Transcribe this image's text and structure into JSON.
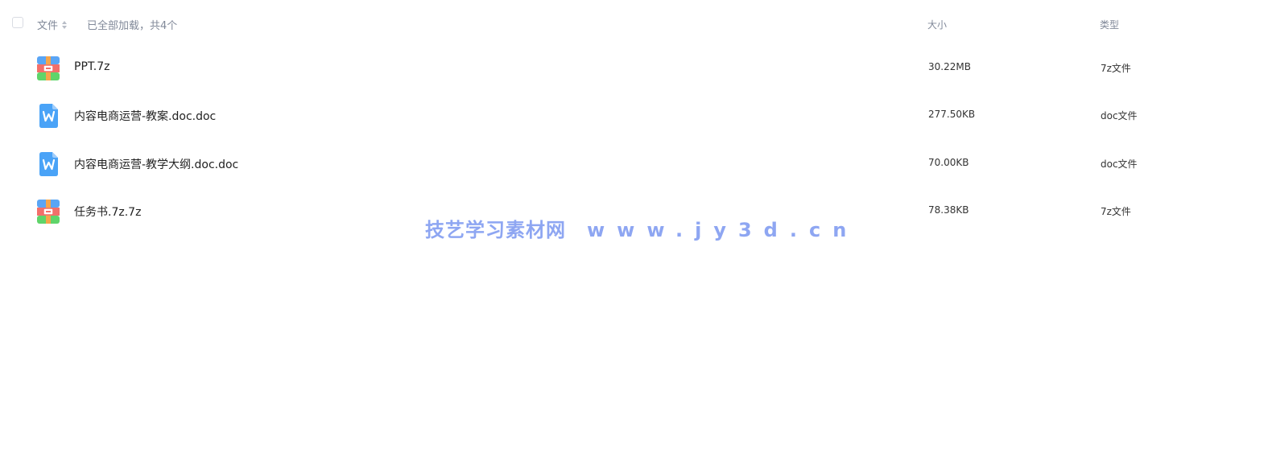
{
  "header": {
    "name_label": "文件",
    "load_status": "已全部加载，共4个",
    "size_label": "大小",
    "type_label": "类型"
  },
  "files": [
    {
      "name": "PPT.7z",
      "size": "30.22MB",
      "type": "7z文件",
      "icon": "archive-icon"
    },
    {
      "name": "内容电商运营-教案.doc.doc",
      "size": "277.50KB",
      "type": "doc文件",
      "icon": "word-doc-icon"
    },
    {
      "name": "内容电商运营-教学大纲.doc.doc",
      "size": "70.00KB",
      "type": "doc文件",
      "icon": "word-doc-icon"
    },
    {
      "name": "任务书.7z.7z",
      "size": "78.38KB",
      "type": "7z文件",
      "icon": "archive-icon"
    }
  ],
  "watermark": {
    "text": "技艺学习素材网",
    "url": "www.jy3d.cn"
  },
  "colors": {
    "header_text": "#818999",
    "watermark": "#8ea6f2",
    "archive_top": "#f36f6a",
    "archive_bottom": "#5fd46a",
    "archive_band": "#f5a54b",
    "word_icon": "#3d9af5"
  }
}
